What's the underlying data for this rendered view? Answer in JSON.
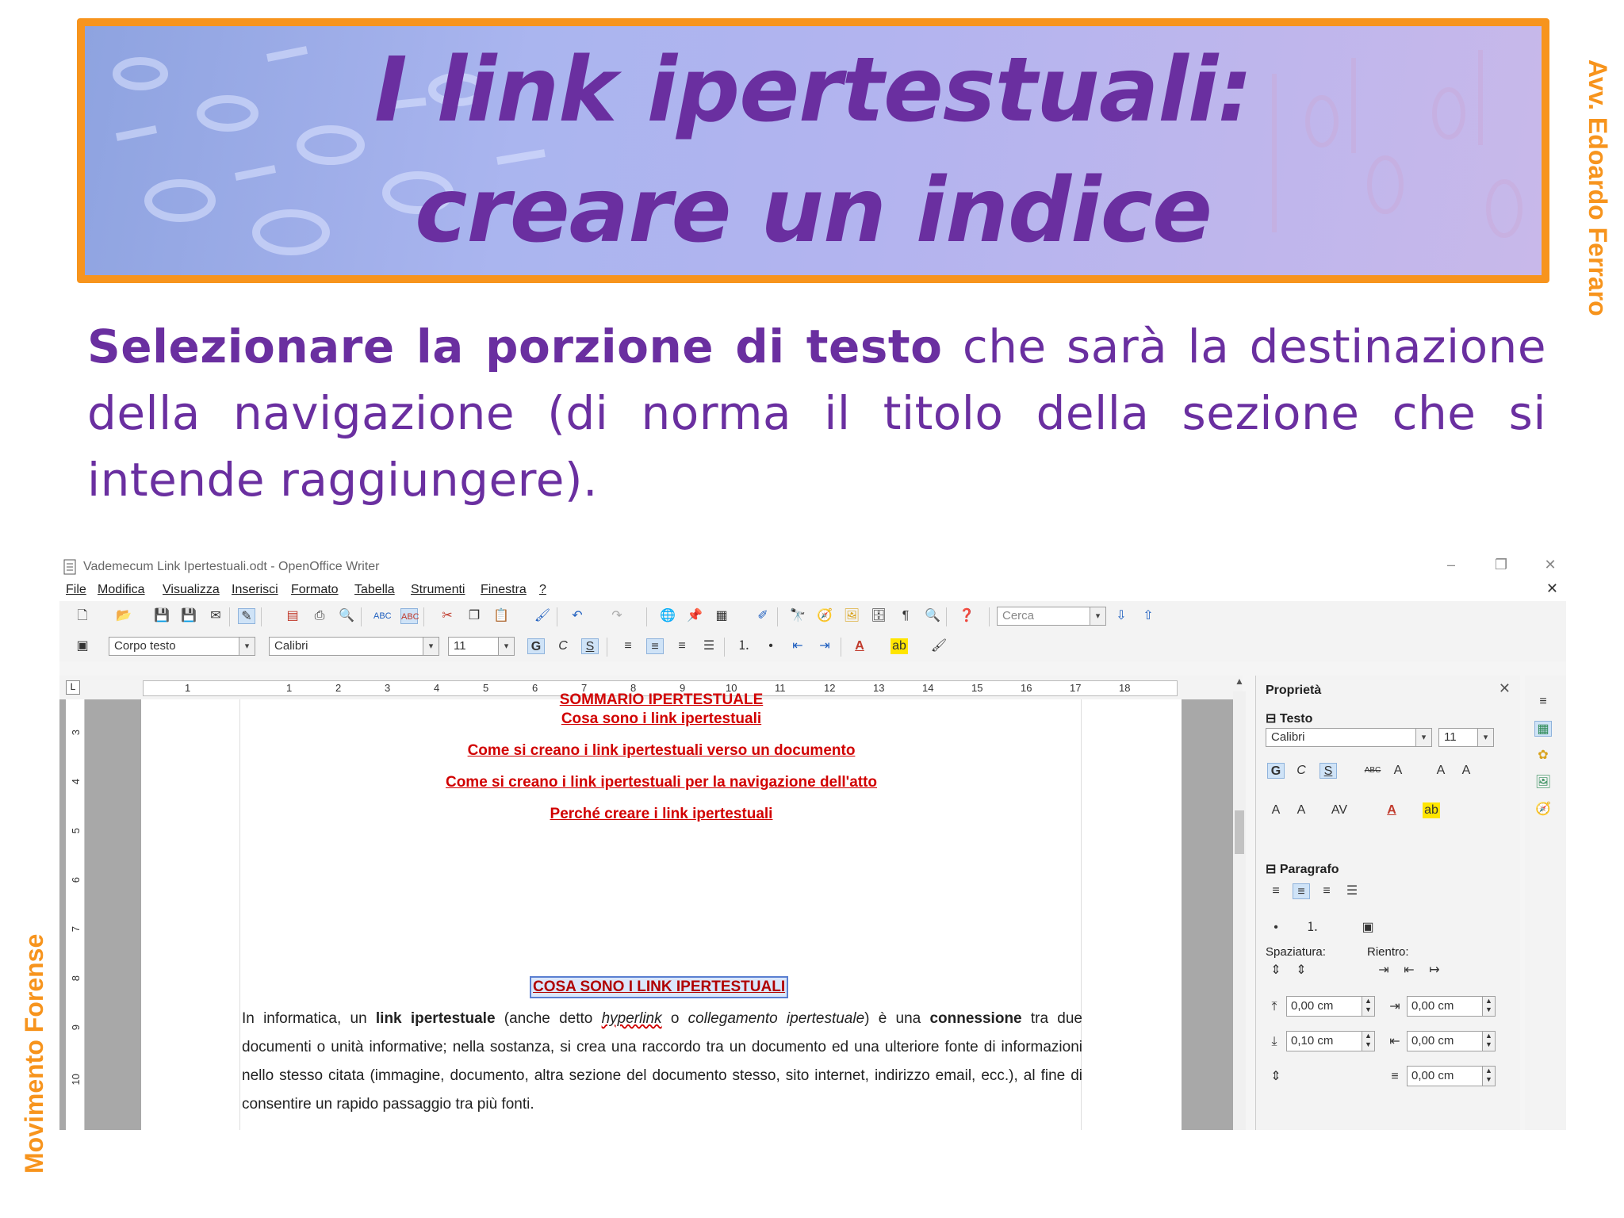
{
  "slide": {
    "title_line1": "I link ipertestuali:",
    "title_line2": "creare un indice",
    "author": "Avv. Edoardo Ferraro",
    "brand": "Movimento Forense",
    "intro_bold": "Selezionare la porzione di testo",
    "intro_rest": " che sarà la destinazione della navigazione (di norma il titolo della sezione che si intende raggiungere).",
    "colors": {
      "accent": "#f7941d",
      "text": "#6a2fa0",
      "title_bg": "#aab5ef"
    }
  },
  "app": {
    "window_title": "Vademecum Link Ipertestuali.odt - OpenOffice Writer",
    "menu": [
      "File",
      "Modifica",
      "Visualizza",
      "Inserisci",
      "Formato",
      "Tabella",
      "Strumenti",
      "Finestra",
      "?"
    ],
    "search_placeholder": "Cerca",
    "paragraph_style": "Corpo testo",
    "font_name": "Calibri",
    "font_size": "11",
    "bold_label": "G",
    "italic_label": "C",
    "underline_label": "S",
    "ruler_numbers": [
      "1",
      "1",
      "2",
      "3",
      "4",
      "5",
      "6",
      "7",
      "8",
      "9",
      "10",
      "11",
      "12",
      "13",
      "14",
      "15",
      "16",
      "17",
      "18"
    ],
    "vruler_numbers": [
      "3",
      "4",
      "5",
      "6",
      "7",
      "8",
      "9",
      "10"
    ]
  },
  "document": {
    "toc_cut": "SOMMARIO IPERTESTUALE",
    "toc_links": [
      "Cosa sono i link ipertestuali",
      "Come si creano i link ipertestuali verso un documento",
      "Come si creano i link ipertestuali per la navigazione dell'atto",
      "Perché creare i link ipertestuali"
    ],
    "section_title": "COSA SONO I LINK IPERTESTUALI",
    "para": {
      "t1": "In informatica, un ",
      "b1": "link ipertestuale",
      "t2": " (anche detto ",
      "i1": "hyperlink",
      "t3": " o ",
      "i2": "collegamento ipertestuale",
      "t4": ") è una ",
      "b2": "connessione",
      "t5": " tra due documenti o unità informative; nella sostanza, si crea una raccordo tra un documento ed una ulteriore fonte di informazioni nello stesso citata (immagine, documento, altra sezione del documento stesso, sito internet, indirizzo email, ecc.), al fine di consentire un rapido passaggio tra più fonti."
    }
  },
  "sidebar": {
    "title": "Proprietà",
    "testo_label": "Testo",
    "font_name": "Calibri",
    "font_size": "11",
    "paragrafo_label": "Paragrafo",
    "spaziatura_label": "Spaziatura:",
    "rientro_label": "Rientro:",
    "spacing_above": "0,00 cm",
    "spacing_below": "0,10 cm",
    "indent_before": "0,00 cm",
    "indent_after": "0,00 cm",
    "indent_first": "0,00 cm"
  }
}
